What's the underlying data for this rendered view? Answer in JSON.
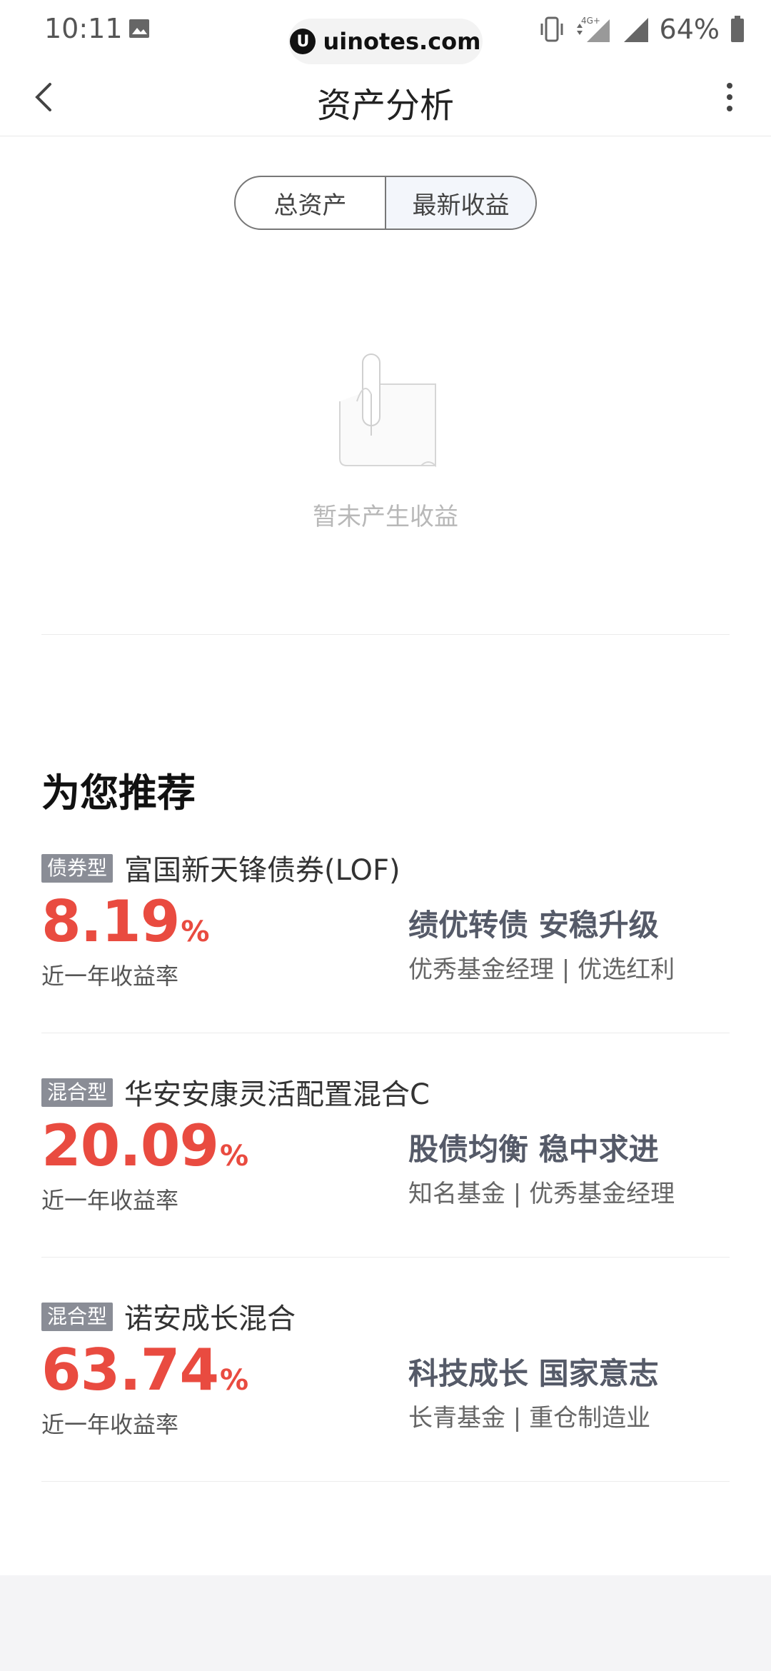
{
  "status_bar": {
    "time": "10:11",
    "network": "4G+",
    "battery": "64%"
  },
  "watermark": {
    "text": "uinotes.com"
  },
  "header": {
    "title": "资产分析"
  },
  "segmented": {
    "tabs": [
      {
        "label": "总资产"
      },
      {
        "label": "最新收益"
      }
    ],
    "selected": "最新收益"
  },
  "empty_state": {
    "text": "暂未产生收益"
  },
  "recommend": {
    "title": "为您推荐",
    "items": [
      {
        "tag": "债券型",
        "name": "富国新天锋债券(LOF)",
        "rate": "8.19",
        "unit": "%",
        "rate_label": "近一年收益率",
        "headline": "绩优转债 安稳升级",
        "sub": "优秀基金经理 | 优选红利"
      },
      {
        "tag": "混合型",
        "name": "华安安康灵活配置混合C",
        "rate": "20.09",
        "unit": "%",
        "rate_label": "近一年收益率",
        "headline": "股债均衡 稳中求进",
        "sub": "知名基金 | 优秀基金经理"
      },
      {
        "tag": "混合型",
        "name": "诺安成长混合",
        "rate": "63.74",
        "unit": "%",
        "rate_label": "近一年收益率",
        "headline": "科技成长 国家意志",
        "sub": "长青基金 | 重仓制造业"
      }
    ]
  },
  "colors": {
    "accent_red": "#e94b40",
    "tag_gray": "#8a8d96"
  }
}
